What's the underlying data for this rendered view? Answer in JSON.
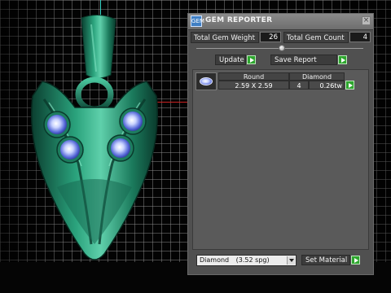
{
  "panel": {
    "title": "GEM REPORTER",
    "app_icon_text": "GEM",
    "close_glyph": "×",
    "total_gem_weight_label": "Total Gem Weight",
    "total_gem_weight_value": "26",
    "total_gem_count_label": "Total Gem Count",
    "total_gem_count_value": "4",
    "update_label": "Update",
    "save_report_label": "Save Report",
    "table": {
      "headers": [
        "Round",
        "Diamond"
      ],
      "rows": [
        {
          "shape": "Round",
          "size": "2.59 X 2.59",
          "material": "Diamond",
          "count": "4",
          "weight": "0.26tw"
        }
      ]
    },
    "material_select": {
      "value": "Diamond",
      "density": "(3.52 spg)"
    },
    "set_material_label": "Set Material"
  },
  "colors": {
    "panel_bg": "#505050",
    "accent_go": "#2ea62e",
    "value_text": "#ffffff",
    "pendant_metal": "#1f8a68",
    "gem_stone": "#5568d8"
  },
  "icons": [
    "app-icon",
    "close-icon",
    "play-arrow-icon",
    "gem-round-icon",
    "dropdown-arrow-icon"
  ]
}
